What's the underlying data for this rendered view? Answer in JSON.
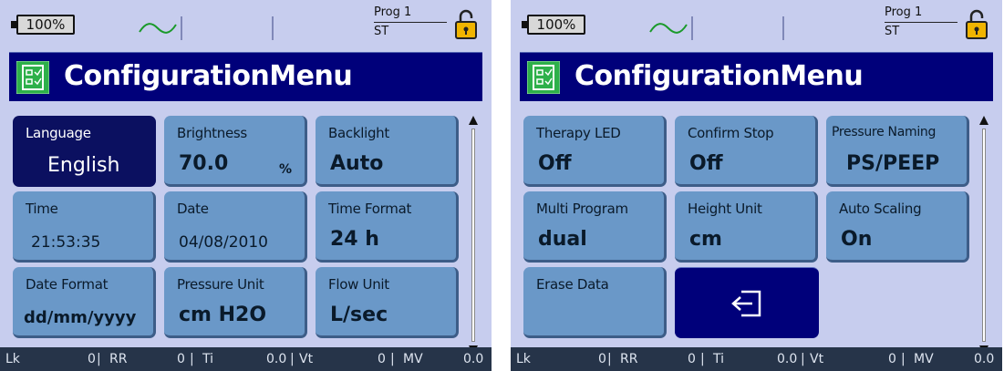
{
  "screens": [
    {
      "status": {
        "battery": "100%",
        "program": "Prog 1",
        "mode": "ST"
      },
      "title": "ConfigurationMenu",
      "tiles": [
        {
          "label": "Language",
          "value": "English"
        },
        {
          "label": "Brightness",
          "value": "70.0",
          "unit": "%"
        },
        {
          "label": "Backlight",
          "value": "Auto"
        },
        {
          "label": "Time",
          "value": "21:53:35"
        },
        {
          "label": "Date",
          "value": "04/08/2010"
        },
        {
          "label": "Time Format",
          "value": "24 h"
        },
        {
          "label": "Date Format",
          "value": "dd/mm/yyyy"
        },
        {
          "label": "Pressure Unit",
          "value": "cm H2O"
        },
        {
          "label": "Flow Unit",
          "value": "L/sec"
        }
      ],
      "bottom": {
        "lk_label": "Lk",
        "lk": "0",
        "rr_label": "RR",
        "rr": "0",
        "ti_label": "Ti",
        "ti": "0.0",
        "vt_label": "Vt",
        "vt": "0",
        "mv_label": "MV",
        "mv": "0.0"
      }
    },
    {
      "status": {
        "battery": "100%",
        "program": "Prog 1",
        "mode": "ST"
      },
      "title": "ConfigurationMenu",
      "tiles": [
        {
          "label": "Therapy LED",
          "value": "Off"
        },
        {
          "label": "Confirm Stop",
          "value": "Off"
        },
        {
          "label": "Pressure Naming",
          "value": "PS/PEEP"
        },
        {
          "label": "Multi Program",
          "value": "dual"
        },
        {
          "label": "Height Unit",
          "value": "cm"
        },
        {
          "label": "Auto Scaling",
          "value": "On"
        },
        {
          "label": "Erase Data",
          "value": ""
        }
      ],
      "bottom": {
        "lk_label": "Lk",
        "lk": "0",
        "rr_label": "RR",
        "rr": "0",
        "ti_label": "Ti",
        "ti": "0.0",
        "vt_label": "Vt",
        "vt": "0",
        "mv_label": "MV",
        "mv": "0.0"
      }
    }
  ],
  "icons": {
    "battery": "battery-icon",
    "wave": "flow-wave-icon",
    "lock": "padlock-open-icon",
    "config": "checklist-icon",
    "back": "back-arrow-icon"
  },
  "colors": {
    "screen_bg": "#c7cdee",
    "title_bar": "#00007a",
    "tile": "#6a98c8",
    "tile_selected": "#0b1060",
    "bottom_bar": "#263449",
    "lock": "#f0b400"
  }
}
